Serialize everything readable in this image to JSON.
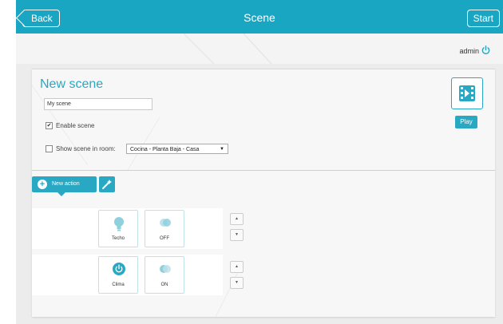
{
  "topbar": {
    "back_label": "Back",
    "title": "Scene",
    "start_label": "Start"
  },
  "user": {
    "name": "admin",
    "power_icon": "power-icon"
  },
  "scene": {
    "heading": "New scene",
    "name_value": "My scene",
    "enable_label": "Enable scene",
    "enable_checked": true,
    "show_in_room_label": "Show scene in room:",
    "show_in_room_checked": false,
    "room_selected": "Cocina - Planta Baja - Casa",
    "play_label": "Play",
    "scene_icon": "film-icon"
  },
  "actions": {
    "new_action_label": "New action",
    "tool_icon": "wand-icon",
    "rows": [
      {
        "device_label": "Techo",
        "device_icon": "bulb-icon",
        "state_label": "OFF",
        "state_icon": "toggle-icon"
      },
      {
        "device_label": "Clima",
        "device_icon": "power-circle-icon",
        "state_label": "ON",
        "state_icon": "toggle-icon"
      }
    ]
  },
  "colors": {
    "accent": "#29a8c4",
    "topbar": "#19a6c3"
  }
}
